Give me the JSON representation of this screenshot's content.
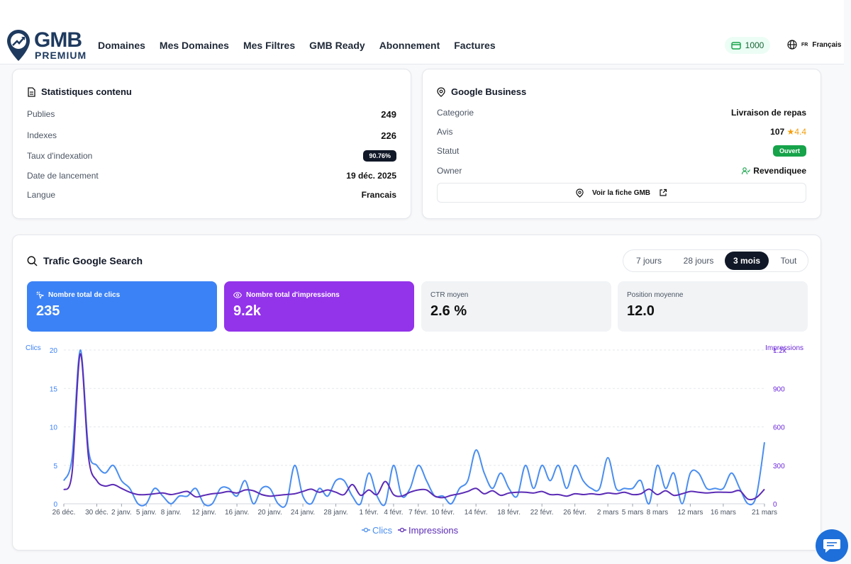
{
  "header": {
    "logo_main": "GMB",
    "logo_sub": "PREMIUM",
    "nav": [
      "Domaines",
      "Mes Domaines",
      "Mes Filtres",
      "GMB Ready",
      "Abonnement",
      "Factures"
    ],
    "credits": "1000",
    "lang_code": "FR",
    "lang_label": "Français"
  },
  "content_stats": {
    "title": "Statistiques contenu",
    "rows": [
      {
        "label": "Publies",
        "value": "249"
      },
      {
        "label": "Indexes",
        "value": "226"
      },
      {
        "label": "Taux d'indexation",
        "value": "90.76%"
      },
      {
        "label": "Date de lancement",
        "value": "19 déc. 2025"
      },
      {
        "label": "Langue",
        "value": "Francais"
      }
    ]
  },
  "google_business": {
    "title": "Google Business",
    "rows": [
      {
        "label": "Categorie",
        "value": "Livraison de repas"
      },
      {
        "label": "Avis",
        "value": "107",
        "rating": "4.4"
      },
      {
        "label": "Statut",
        "value": "Ouvert"
      },
      {
        "label": "Owner",
        "value": "Revendiquee"
      }
    ],
    "button": "Voir la fiche GMB"
  },
  "traffic": {
    "title": "Trafic Google Search",
    "tabs": [
      "7 jours",
      "28 jours",
      "3 mois",
      "Tout"
    ],
    "active_tab": "3 mois",
    "stats": [
      {
        "label": "Nombre total de clics",
        "value": "235"
      },
      {
        "label": "Nombre total d'impressions",
        "value": "9.2k"
      },
      {
        "label": "CTR moyen",
        "value": "2.6 %"
      },
      {
        "label": "Position moyenne",
        "value": "12.0"
      }
    ]
  },
  "colors": {
    "clics": "#4a8ef0",
    "impressions": "#5b2bb5",
    "blue_card": "#3b82f6",
    "purple_card": "#9333ea"
  },
  "chart_data": {
    "type": "line",
    "left_axis_label": "Clics",
    "right_axis_label": "Impressions",
    "left_ticks": [
      "0",
      "5",
      "10",
      "15",
      "20"
    ],
    "right_ticks": [
      "0",
      "300",
      "600",
      "900",
      "1.2k"
    ],
    "ylim_left": [
      0,
      20
    ],
    "ylim_right": [
      0,
      1200
    ],
    "x_tick_labels": [
      "26 déc.",
      "30 déc.",
      "2 janv.",
      "5 janv.",
      "8 janv.",
      "12 janv.",
      "16 janv.",
      "20 janv.",
      "24 janv.",
      "28 janv.",
      "1 févr.",
      "4 févr.",
      "7 févr.",
      "10 févr.",
      "14 févr.",
      "18 févr.",
      "22 févr.",
      "26 févr.",
      "2 mars",
      "5 mars",
      "8 mars",
      "12 mars",
      "16 mars",
      "21 mars"
    ],
    "x_tick_index": [
      0,
      4,
      7,
      10,
      13,
      17,
      21,
      25,
      29,
      33,
      37,
      40,
      43,
      46,
      50,
      54,
      58,
      62,
      66,
      69,
      72,
      76,
      80,
      85
    ],
    "series": [
      {
        "name": "Clics",
        "axis": "left",
        "values": [
          3,
          6,
          20,
          7,
          5,
          4,
          5,
          3,
          2,
          0,
          0,
          2,
          1,
          0,
          1,
          1,
          2,
          0,
          0,
          2,
          2,
          1,
          3,
          0,
          2,
          2,
          0,
          0,
          5,
          1,
          0,
          2,
          1,
          3,
          3,
          1,
          0,
          4,
          1,
          0,
          5,
          1,
          2,
          5,
          3,
          1,
          1,
          0,
          2,
          3,
          7,
          4,
          2,
          4,
          2,
          1,
          5,
          2,
          5,
          3,
          5,
          2,
          5,
          3,
          2,
          2,
          6,
          2,
          2,
          2,
          3,
          0,
          5,
          2,
          4,
          0,
          4,
          4,
          2,
          2,
          2,
          4,
          2,
          0,
          1,
          8
        ]
      },
      {
        "name": "Impressions",
        "axis": "left",
        "values": [
          1.8,
          4,
          19.5,
          6,
          3,
          2.3,
          2.5,
          2,
          1.5,
          1.2,
          1.2,
          1.3,
          1.4,
          1.2,
          1.4,
          1.6,
          0.9,
          1.1,
          1.3,
          1.4,
          1.6,
          1.4,
          1.8,
          1.7,
          1.2,
          1,
          1.1,
          1.2,
          1.3,
          1.6,
          1.9,
          1.5,
          1.8,
          1.5,
          1.2,
          2.5,
          1.1,
          1.8,
          1.2,
          2.9,
          1.2,
          1,
          1.5,
          1.8,
          1.8,
          1,
          0.8,
          1.1,
          1.3,
          1.6,
          2,
          1.3,
          1.7,
          1.1,
          1.4,
          1.5,
          1.5,
          1.4,
          1.6,
          1.2,
          1.2,
          1,
          1.3,
          1.2,
          1.3,
          1.2,
          1.4,
          1.3,
          1.5,
          1.2,
          1.3,
          1.9,
          1.2,
          1.7,
          1.1,
          1.3,
          1.6,
          1.5,
          1.4,
          1.5,
          1.5,
          1.5,
          1.7,
          0.6,
          0.8,
          1.9
        ]
      }
    ],
    "legend": [
      "Clics",
      "Impressions"
    ]
  }
}
